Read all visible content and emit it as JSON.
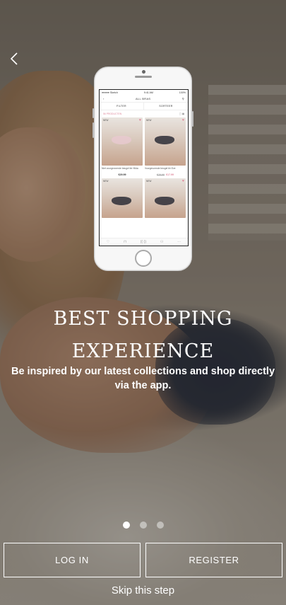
{
  "back": {
    "icon": "chevron-left-icon"
  },
  "phone_screen": {
    "status": {
      "carrier": "●●●●● Sketch",
      "time": "9:41 AM",
      "battery": "100%"
    },
    "nav_title": "ALL BRAS",
    "filter_label": "FILTER",
    "sort_label": "SORTEER",
    "results_label": "56 PRODUCTEN",
    "products": [
      {
        "tag": "NEW",
        "name": "Niet voorgevormde beugel bh Hilda",
        "price": "€29.99",
        "old_price": "",
        "sale_price": ""
      },
      {
        "tag": "NEW",
        "name": "Voorgevormde beugel bh Eve",
        "price": "",
        "old_price": "€29.99",
        "sale_price": "€17.99"
      },
      {
        "tag": "NEW",
        "name": "",
        "price": "",
        "old_price": "",
        "sale_price": ""
      },
      {
        "tag": "NEW",
        "name": "",
        "price": "",
        "old_price": "",
        "sale_price": ""
      }
    ]
  },
  "headline": {
    "line1": "BEST SHOPPING",
    "line2": "EXPERIENCE"
  },
  "subtext": "Be inspired by our latest collections and shop directly via the app.",
  "pagination": {
    "total": 3,
    "active": 0
  },
  "buttons": {
    "login": "LOG IN",
    "register": "REGISTER"
  },
  "skip": "Skip this step",
  "colors": {
    "accent_pink": "#e08a9d",
    "text": "#ffffff"
  }
}
